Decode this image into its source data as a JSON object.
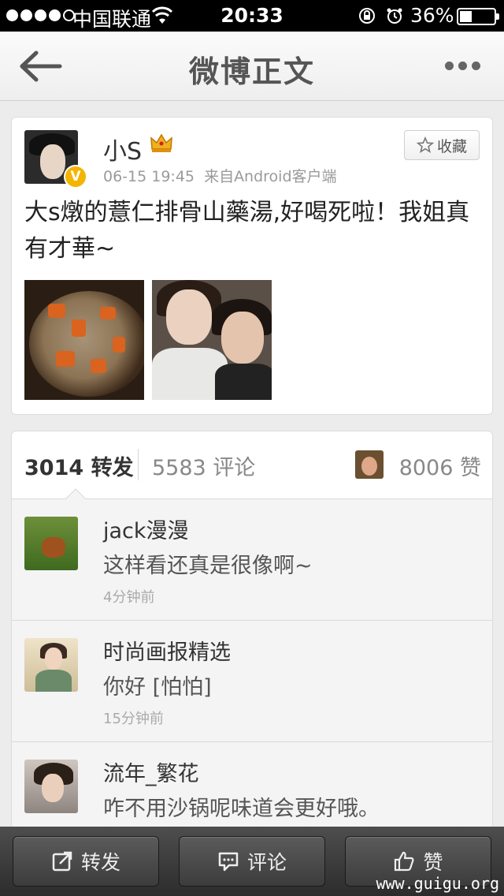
{
  "status_bar": {
    "carrier": "中国联通",
    "time": "20:33",
    "battery": "36%",
    "battery_level": 0.36
  },
  "nav": {
    "title": "微博正文",
    "back_icon": "back-arrow-icon",
    "more_icon": "more-dots-icon"
  },
  "post": {
    "username": "小S",
    "timestamp": "06-15 19:45",
    "source": "来自Android客户端",
    "favorite_label": "收藏",
    "text": "大s燉的薏仁排骨山藥湯,好喝死啦！我姐真有才華~",
    "verified_badge": "V"
  },
  "stats": {
    "repost_count": "3014",
    "repost_label": "转发",
    "comment_count": "5583",
    "comment_label": "评论",
    "like_count": "8006",
    "like_label": "赞"
  },
  "comments": [
    {
      "name": "jack漫漫",
      "text": "这样看还真是很像啊~",
      "time": "4分钟前"
    },
    {
      "name": "时尚画报精选",
      "text": "你好 [怕怕]",
      "time": "15分钟前"
    },
    {
      "name": "流年_繁花",
      "text": "咋不用沙锅呢味道会更好哦。",
      "time": ""
    }
  ],
  "toolbar": {
    "repost_label": "转发",
    "comment_label": "评论",
    "like_label": "赞"
  },
  "watermark": "www.guigu.org",
  "colors": {
    "badge": "#f4b400",
    "toolbar": "#3c3c3c",
    "accent_text": "#333333"
  }
}
